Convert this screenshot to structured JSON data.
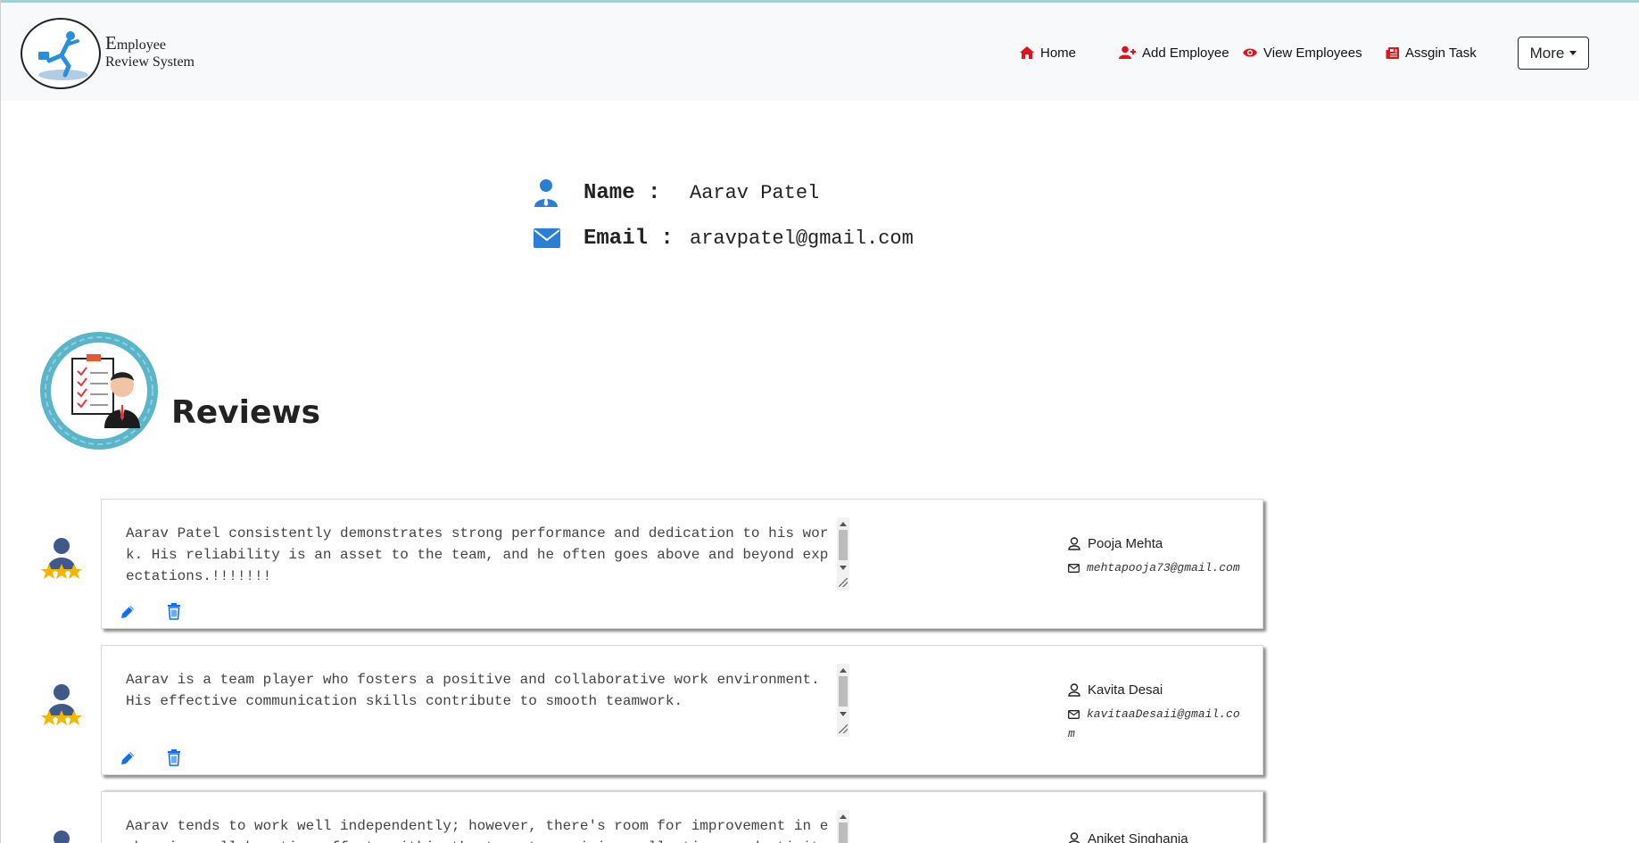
{
  "brand": {
    "initial": "E",
    "line1": "mployee",
    "line2": "Review System"
  },
  "nav": {
    "home": "Home",
    "add_employee": "Add Employee",
    "view_employees": "View Employees",
    "assign_task": "Assgin Task",
    "more": "More"
  },
  "profile": {
    "name_label": "Name :",
    "name_value": "Aarav Patel",
    "email_label": "Email :",
    "email_value": "aravpatel@gmail.com"
  },
  "reviews_title": "Reviews",
  "reviews": [
    {
      "text": "Aarav Patel consistently demonstrates strong performance and dedication to his work. His reliability is an asset to the team, and he often goes above and beyond expectations.!!!!!!!",
      "author": "Pooja Mehta",
      "email": "mehtapooja73@gmail.com"
    },
    {
      "text": "Aarav is a team player who fosters a positive and collaborative work environment. His effective communication skills contribute to smooth teamwork.",
      "author": "Kavita Desai",
      "email": "kavitaaDesaii@gmail.com"
    },
    {
      "text": "Aarav tends to work well independently; however, there's room for improvement in enhancing collaborative efforts within the team to maximize collective productivity.",
      "author": "Aniket Singhania",
      "email": ""
    }
  ],
  "colors": {
    "nav_icon_red": "#e3111b",
    "profile_icon_blue": "#2a7fd4",
    "action_blue": "#0d6efd",
    "review_avatar_teal": "#5bb5c9",
    "star_gold": "#f2b705"
  }
}
